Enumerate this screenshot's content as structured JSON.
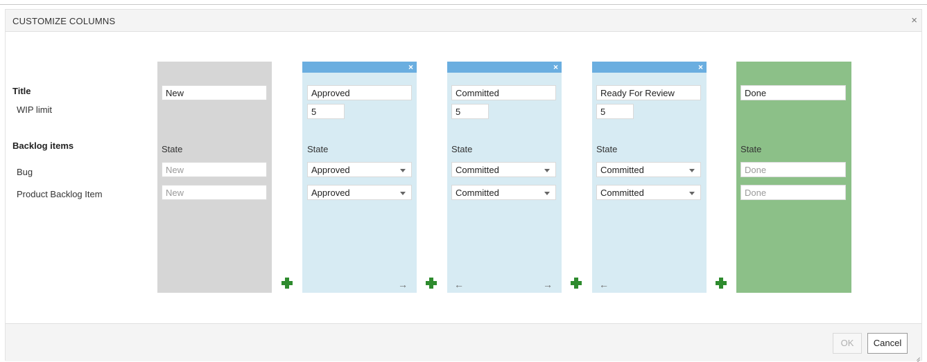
{
  "dialog": {
    "title": "CUSTOMIZE COLUMNS",
    "close_icon": "×"
  },
  "rows": {
    "title_label": "Title",
    "wip_label": "WIP limit",
    "backlog_label": "Backlog items",
    "bug_label": "Bug",
    "pbi_label": "Product Backlog Item"
  },
  "columns": [
    {
      "title": "New",
      "wip": "",
      "state_label": "State",
      "bug_state": "New",
      "pbi_state": "New",
      "kind": "incoming"
    },
    {
      "title": "Approved",
      "wip": "5",
      "state_label": "State",
      "bug_state": "Approved",
      "pbi_state": "Approved",
      "kind": "inprogress"
    },
    {
      "title": "Committed",
      "wip": "5",
      "state_label": "State",
      "bug_state": "Committed",
      "pbi_state": "Committed",
      "kind": "inprogress"
    },
    {
      "title": "Ready For Review",
      "wip": "5",
      "state_label": "State",
      "bug_state": "Committed",
      "pbi_state": "Committed",
      "kind": "inprogress"
    },
    {
      "title": "Done",
      "wip": "",
      "state_label": "State",
      "bug_state": "Done",
      "pbi_state": "Done",
      "kind": "outgoing"
    }
  ],
  "icons": {
    "remove_column": "×",
    "move_right": "→",
    "move_left": "←"
  },
  "colors": {
    "incoming": "#d6d6d6",
    "inprogress": "#d7ebf3",
    "outgoing": "#8cc088",
    "column_bar": "#6aaee0",
    "add_icon": "#2e8b2e"
  },
  "footer": {
    "ok_label": "OK",
    "cancel_label": "Cancel"
  }
}
